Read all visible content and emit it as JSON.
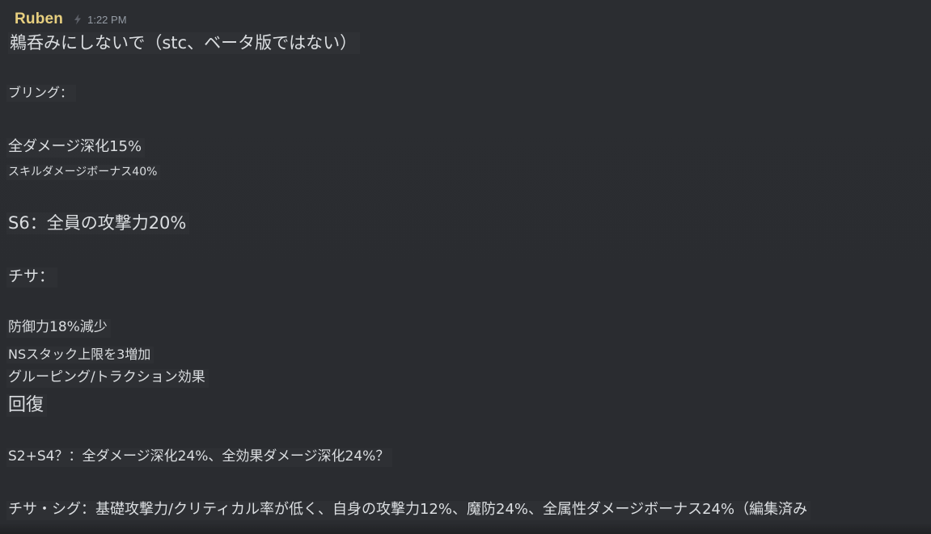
{
  "message": {
    "author": "Ruben",
    "timestamp": "1:22 PM",
    "badge_icon": "lightning-icon",
    "author_color": "#e7cf7f",
    "lines": [
      "鵜呑みにしないで（stc、ベータ版ではない）",
      "ブリング：",
      "全ダメージ深化15%",
      "スキルダメージボーナス40%",
      "S6：全員の攻撃力20%",
      "チサ：",
      "防御力18%減少",
      "NSスタック上限を3増加",
      "グルーピング/トラクション効果",
      "回復",
      "S2+S4？：全ダメージ深化24%、全効果ダメージ深化24%？",
      "チサ・シグ：基礎攻撃力/クリティカル率が低く、自身の攻撃力12%、魔防24%、全属性ダメージボーナス24%（編集済み"
    ]
  }
}
